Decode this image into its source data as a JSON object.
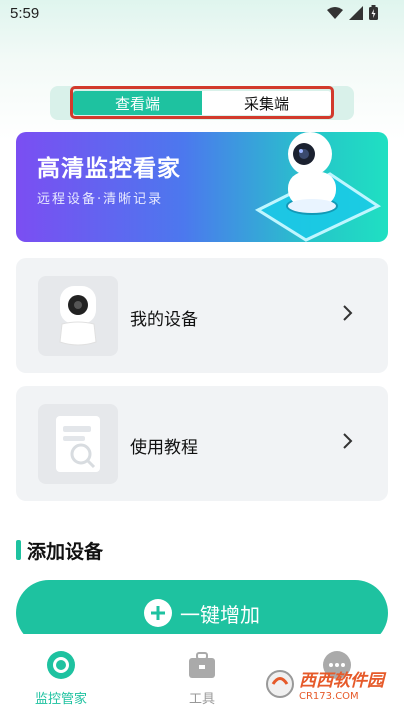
{
  "status_bar": {
    "time": "5:59"
  },
  "segment": {
    "tabs": [
      {
        "label": "查看端",
        "active": true
      },
      {
        "label": "采集端",
        "active": false
      }
    ]
  },
  "banner": {
    "title": "高清监控看家",
    "subtitle": "远程设备·清晰记录"
  },
  "cards": [
    {
      "label": "我的设备",
      "icon": "camera-icon"
    },
    {
      "label": "使用教程",
      "icon": "document-icon"
    }
  ],
  "section": {
    "title": "添加设备"
  },
  "add_button": {
    "label": "一键增加"
  },
  "tab_bar": {
    "items": [
      {
        "label": "监控管家",
        "icon": "camera-eye-icon",
        "active": true
      },
      {
        "label": "工具",
        "icon": "toolbox-icon",
        "active": false
      },
      {
        "label": "",
        "icon": "more-icon",
        "active": false
      }
    ]
  },
  "watermark": {
    "text": "西西软件园",
    "url": "CR173.COM"
  },
  "colors": {
    "accent": "#1ec2a0",
    "highlight_border": "#d23a2c"
  }
}
